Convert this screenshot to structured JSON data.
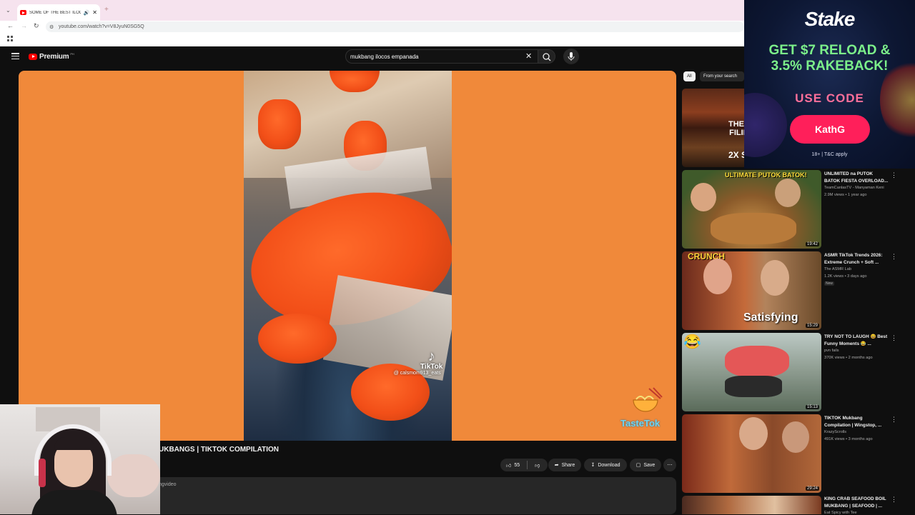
{
  "browser": {
    "tab_title": "SOME OF THE BEST ILOCO...",
    "new_tab": "+",
    "url": "youtube.com/watch?v=V8JyuN0SG5Q"
  },
  "youtube": {
    "logo_text": "Premium",
    "logo_sup": "PH",
    "search_query": "mukbang ilocos empanada"
  },
  "video": {
    "tiktok_label": "TikTok",
    "tiktok_handle": "@ calsmom913_eats",
    "watermark": "TasteTok",
    "title_visible": "UKBANGS | TIKTOK COMPILATION",
    "desc_fragment": "ngvideo",
    "likes": "55",
    "share_label": "Share",
    "download_label": "Download",
    "save_label": "Save",
    "more": "⋯"
  },
  "sidebar": {
    "chips": [
      "All",
      "From your search"
    ],
    "partial_thumb_text": [
      "THE",
      "FILIP",
      "2X S"
    ],
    "videos": [
      {
        "title": "UNLIMITED na PUTOK BATOK FIESTA OVERLOAD...",
        "channel": "TeamCanlasTV - Manyaman Keni",
        "meta": "2.9M views • 1 year ago",
        "duration": "19:42",
        "thumb_text": "ULTIMATE PUTOK BATOK!",
        "badge": ""
      },
      {
        "title": "ASMR TikTok Trends 2026: Extreme Crunch + Soft ...",
        "channel": "The ASMR Lab",
        "meta": "1.2K views • 3 days ago",
        "duration": "15:29",
        "thumb_text": "CRUNCH",
        "thumb_text2": "Satisfying",
        "badge": "New"
      },
      {
        "title": "TRY NOT TO LAUGH 😆 Best Funny Moments 😂 ...",
        "channel": "pvn fails",
        "meta": "370K views • 2 months ago",
        "duration": "15:13",
        "thumb_text": "😂",
        "badge": ""
      },
      {
        "title": "TIKTOK Mukbang Compilation | Wingstop, ...",
        "channel": "KrazyScrolls",
        "meta": "491K views • 3 months ago",
        "duration": "29:24",
        "thumb_text": "",
        "badge": ""
      },
      {
        "title": "KING CRAB SEAFOOD BOIL MUKBANG | SEAFOOD | ...",
        "channel": "Eat Spicy with Tee",
        "meta": "",
        "duration": "",
        "thumb_text": "",
        "badge": ""
      }
    ]
  },
  "ad": {
    "brand": "Stake",
    "headline": "GET $7 RELOAD & 3.5% RAKEBACK!",
    "code_label": "USE CODE",
    "cta": "KathG",
    "terms": "18+ | T&C apply"
  },
  "colors": {
    "video_bg": "#f0893a",
    "page_bg": "#0f0f0f",
    "accent_red": "#ff0000",
    "ad_green": "#7cf08a",
    "ad_pink": "#ff1f5a"
  }
}
